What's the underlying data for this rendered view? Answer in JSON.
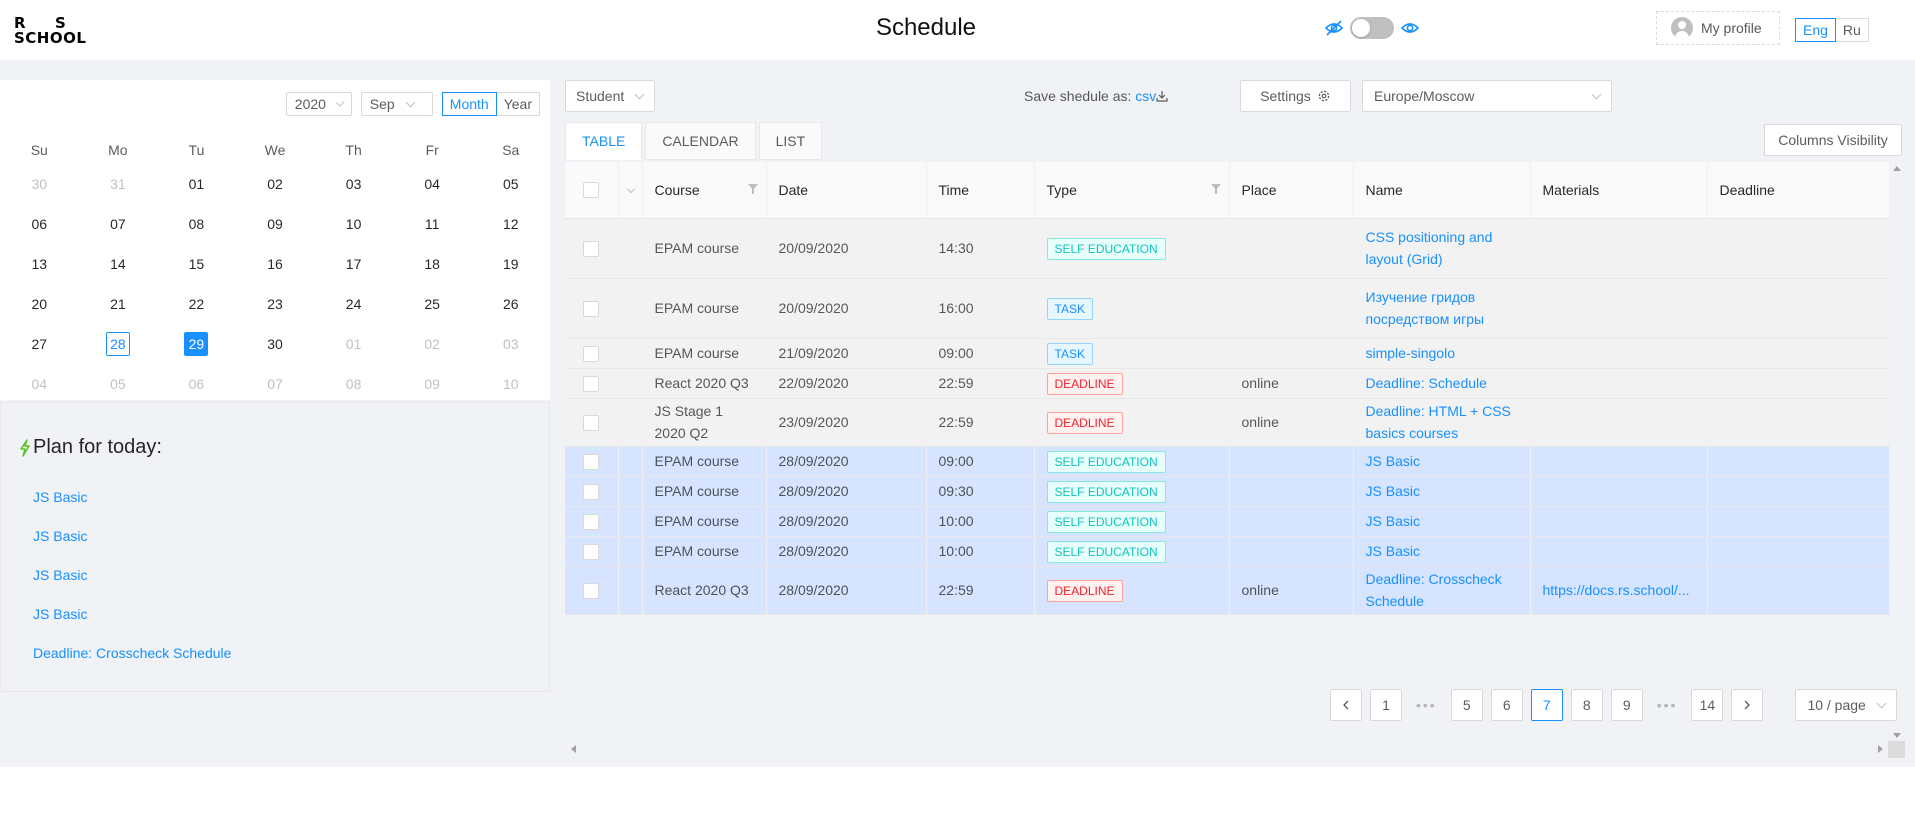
{
  "header": {
    "logo": {
      "r": "R",
      "s": "S",
      "school": "SCHOOL"
    },
    "title": "Schedule",
    "profile_label": "My profile",
    "languages": [
      "Eng",
      "Ru"
    ],
    "active_language": "Eng",
    "accent_color": "#1890ff"
  },
  "calendar": {
    "year": "2020",
    "month": "Sep",
    "modes": [
      "Month",
      "Year"
    ],
    "active_mode": "Month",
    "weekdays": [
      "Su",
      "Mo",
      "Tu",
      "We",
      "Th",
      "Fr",
      "Sa"
    ],
    "weeks": [
      [
        "30",
        "31",
        "01",
        "02",
        "03",
        "04",
        "05"
      ],
      [
        "06",
        "07",
        "08",
        "09",
        "10",
        "11",
        "12"
      ],
      [
        "13",
        "14",
        "15",
        "16",
        "17",
        "18",
        "19"
      ],
      [
        "20",
        "21",
        "22",
        "23",
        "24",
        "25",
        "26"
      ],
      [
        "27",
        "28",
        "29",
        "30",
        "01",
        "02",
        "03"
      ],
      [
        "04",
        "05",
        "06",
        "07",
        "08",
        "09",
        "10"
      ]
    ],
    "today": "28",
    "selected": "29"
  },
  "plan": {
    "title": "Plan for today:",
    "items": [
      "JS Basic",
      "JS Basic",
      "JS Basic",
      "JS Basic",
      "Deadline: Crosscheck Schedule"
    ]
  },
  "toolbar": {
    "role": "Student",
    "save_label": "Save shedule as:",
    "save_format": "csv",
    "settings_label": "Settings",
    "timezone": "Europe/Moscow",
    "column_visibility_label": "Columns Visibility"
  },
  "tabs": [
    "TABLE",
    "CALENDAR",
    "LIST"
  ],
  "active_tab": "TABLE",
  "table": {
    "columns": [
      "Course",
      "Date",
      "Time",
      "Type",
      "Place",
      "Name",
      "Materials",
      "Deadline"
    ],
    "rows": [
      {
        "course": "EPAM course",
        "date": "20/09/2020",
        "time": "14:30",
        "type": "SELF EDUCATION",
        "place": "",
        "name": "CSS positioning and layout (Grid)",
        "materials": "",
        "deadline": ""
      },
      {
        "course": "EPAM course",
        "date": "20/09/2020",
        "time": "16:00",
        "type": "TASK",
        "place": "",
        "name": "Изучение гридов посредством игры",
        "materials": "",
        "deadline": ""
      },
      {
        "course": "EPAM course",
        "date": "21/09/2020",
        "time": "09:00",
        "type": "TASK",
        "place": "",
        "name": "simple-singolo",
        "materials": "",
        "deadline": ""
      },
      {
        "course": "React 2020 Q3",
        "date": "22/09/2020",
        "time": "22:59",
        "type": "DEADLINE",
        "place": "online",
        "name": "Deadline: Schedule",
        "materials": "",
        "deadline": ""
      },
      {
        "course": "JS Stage 1 2020 Q2",
        "date": "23/09/2020",
        "time": "22:59",
        "type": "DEADLINE",
        "place": "online",
        "name": "Deadline: HTML + CSS basics courses",
        "materials": "",
        "deadline": ""
      },
      {
        "course": "EPAM course",
        "date": "28/09/2020",
        "time": "09:00",
        "type": "SELF EDUCATION",
        "place": "",
        "name": "JS Basic",
        "materials": "",
        "deadline": ""
      },
      {
        "course": "EPAM course",
        "date": "28/09/2020",
        "time": "09:30",
        "type": "SELF EDUCATION",
        "place": "",
        "name": "JS Basic",
        "materials": "",
        "deadline": ""
      },
      {
        "course": "EPAM course",
        "date": "28/09/2020",
        "time": "10:00",
        "type": "SELF EDUCATION",
        "place": "",
        "name": "JS Basic",
        "materials": "",
        "deadline": ""
      },
      {
        "course": "EPAM course",
        "date": "28/09/2020",
        "time": "10:00",
        "type": "SELF EDUCATION",
        "place": "",
        "name": "JS Basic",
        "materials": "",
        "deadline": ""
      },
      {
        "course": "React 2020 Q3",
        "date": "28/09/2020",
        "time": "22:59",
        "type": "DEADLINE",
        "place": "online",
        "name": "Deadline: Crosscheck Schedule",
        "materials": "https://docs.rs.school/...",
        "deadline": ""
      }
    ]
  },
  "pagination": {
    "pages": [
      "1",
      "•••",
      "5",
      "6",
      "7",
      "8",
      "9",
      "•••",
      "14"
    ],
    "current": "7",
    "page_size": "10 / page"
  }
}
